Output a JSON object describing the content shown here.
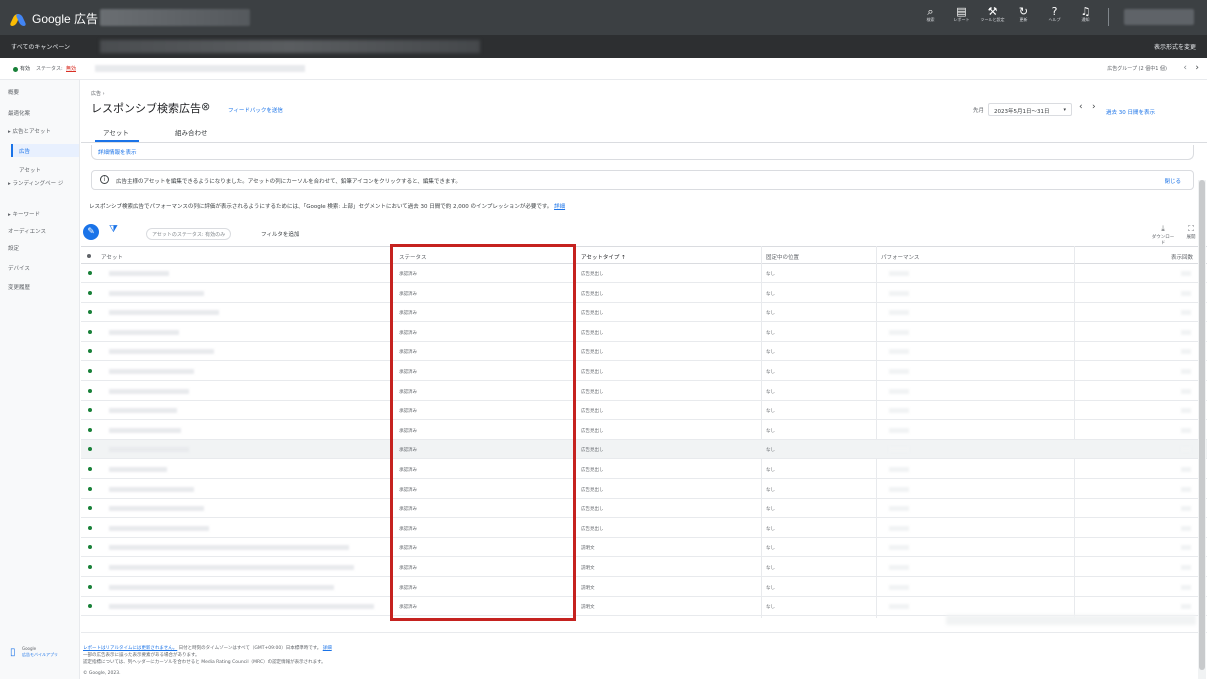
{
  "app": {
    "logo_text": "Google 広告"
  },
  "topbar": {
    "icons": [
      {
        "glyph": "⌕",
        "label": "検索",
        "icon": "search-icon"
      },
      {
        "glyph": "▤",
        "label": "レポート",
        "icon": "report-icon"
      },
      {
        "glyph": "⚒",
        "label": "ツールと設定",
        "icon": "tools-icon"
      },
      {
        "glyph": "↻",
        "label": "更新",
        "icon": "refresh-icon"
      },
      {
        "glyph": "?",
        "label": "ヘルプ",
        "icon": "help-icon"
      },
      {
        "glyph": "♫",
        "label": "通知",
        "icon": "bell-icon"
      }
    ]
  },
  "subbar": {
    "all_campaigns": "すべてのキャンペーン",
    "display_settings": "表示形式を変更"
  },
  "statusbar": {
    "enabled": "有効",
    "status_label": "ステータス:",
    "status_value": "無効",
    "ad_group": "広告グループ (2 個中1 個)",
    "prev": "‹",
    "next": "›"
  },
  "sidebar": {
    "items": [
      "概要",
      "最適化案",
      "▸ 広告とアセット",
      "広告",
      "アセット",
      "▸ ランディングペー ジ",
      "▸ キーワード",
      "オーディエンス",
      "設定",
      "デバイス",
      "変更履歴"
    ],
    "footer_line1": "Google",
    "footer_line2": "広告モバイルアプリ"
  },
  "header": {
    "breadcrumb": "広告 ›",
    "title": "レスポンシブ検索広告",
    "close_glyph": "⊗",
    "feedback": "フィードバックを送信",
    "period_label": "先月",
    "date_range": "2023年5月1日〜31日",
    "dropdown": "▾",
    "prev": "‹",
    "next": "›",
    "last30": "過去 30 日間を表示"
  },
  "tabs": [
    {
      "label": "アセット",
      "active": true
    },
    {
      "label": "組み合わせ",
      "active": false
    }
  ],
  "detail_link": "詳細情報を表示",
  "info": {
    "icon": "i",
    "text": "広告主様のアセットを編集できるようになりました。アセットの列にカーソルを合わせて、鉛筆アイコンをクリックすると、編集できます。",
    "close": "閉じる"
  },
  "perf_note": {
    "text": "レスポンシブ検索広告でパフォーマンスの列に評価が表示されるようにするためには、「Google 検索: 上部」セグメントにおいて過去 30 日間で約 2,000 のインプレッションが必要です。",
    "link": "詳細"
  },
  "toolbar": {
    "edit_glyph": "✎",
    "filter_glyph": "⧩",
    "chip": "アセットのステータス: 有効のみ",
    "add_filter": "フィルタを追加",
    "download": "ダウンロード",
    "download_glyph": "⤓",
    "expand": "展開",
    "expand_glyph": "⛶"
  },
  "table": {
    "headers": {
      "asset": "アセット",
      "status": "ステータス",
      "asset_type": "アセットタイプ ↑",
      "pinned": "固定中の位置",
      "performance": "パフォーマンス",
      "impressions": "表示回数"
    },
    "rows": [
      {
        "status": "承認済み",
        "type": "広告見出し",
        "pinned": "なし"
      },
      {
        "status": "承認済み",
        "type": "広告見出し",
        "pinned": "なし"
      },
      {
        "status": "承認済み",
        "type": "広告見出し",
        "pinned": "なし"
      },
      {
        "status": "承認済み",
        "type": "広告見出し",
        "pinned": "なし"
      },
      {
        "status": "承認済み",
        "type": "広告見出し",
        "pinned": "なし"
      },
      {
        "status": "承認済み",
        "type": "広告見出し",
        "pinned": "なし"
      },
      {
        "status": "承認済み",
        "type": "広告見出し",
        "pinned": "なし"
      },
      {
        "status": "承認済み",
        "type": "広告見出し",
        "pinned": "なし"
      },
      {
        "status": "承認済み",
        "type": "広告見出し",
        "pinned": "なし"
      },
      {
        "status": "承認済み",
        "type": "広告見出し",
        "pinned": "なし"
      },
      {
        "status": "承認済み",
        "type": "広告見出し",
        "pinned": "なし"
      },
      {
        "status": "承認済み",
        "type": "広告見出し",
        "pinned": "なし"
      },
      {
        "status": "承認済み",
        "type": "広告見出し",
        "pinned": "なし"
      },
      {
        "status": "承認済み",
        "type": "広告見出し",
        "pinned": "なし"
      },
      {
        "status": "承認済み",
        "type": "説明文",
        "pinned": "なし"
      },
      {
        "status": "承認済み",
        "type": "説明文",
        "pinned": "なし"
      },
      {
        "status": "承認済み",
        "type": "説明文",
        "pinned": "なし"
      },
      {
        "status": "承認済み",
        "type": "説明文",
        "pinned": "なし"
      }
    ]
  },
  "footer": {
    "line1_link": "レポートはリアルタイムには更新されません。",
    "line1_text": "日付と時刻のタイムゾーンはすべて（GMT+09:00）日本標準時です。",
    "line1_link2": "詳細",
    "line2": "一部の広告表示に誤った表示要素がある場合があります。",
    "line3": "認定指標については、列ヘッダーにカーソルを合わせると Media Rating Council（MRC）の認定情報が表示されます。",
    "copyright": "© Google, 2023."
  },
  "colors": {
    "accent": "#1a73e8",
    "highlight_border": "#c5221f",
    "status_green": "#188038"
  }
}
